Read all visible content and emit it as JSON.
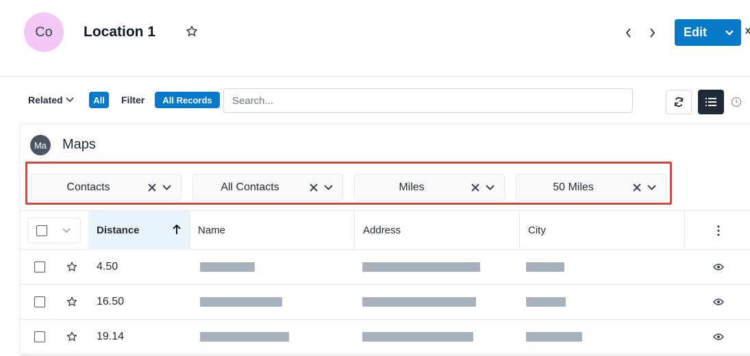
{
  "header": {
    "avatar_initials": "Co",
    "title": "Location 1",
    "edit_label": "Edit"
  },
  "toolbar": {
    "related_label": "Related",
    "all_pill": "All",
    "filter_label": "Filter",
    "all_records_pill": "All Records",
    "search_placeholder": "Search..."
  },
  "dashlet": {
    "avatar_initials": "Ma",
    "title": "Maps",
    "filters": [
      {
        "value": "Contacts"
      },
      {
        "value": "All Contacts"
      },
      {
        "value": "Miles"
      },
      {
        "value": "50 Miles"
      }
    ]
  },
  "table": {
    "columns": [
      "Distance",
      "Name",
      "Address",
      "City"
    ],
    "sorted_column": "Distance",
    "rows": [
      {
        "distance": "4.50"
      },
      {
        "distance": "16.50"
      },
      {
        "distance": "19.14"
      }
    ]
  },
  "colors": {
    "accent": "#0679c8",
    "highlight_box": "#d0493b",
    "avatar_co": "#f3c8f6",
    "redacted_bar": "#a8b2bd"
  }
}
